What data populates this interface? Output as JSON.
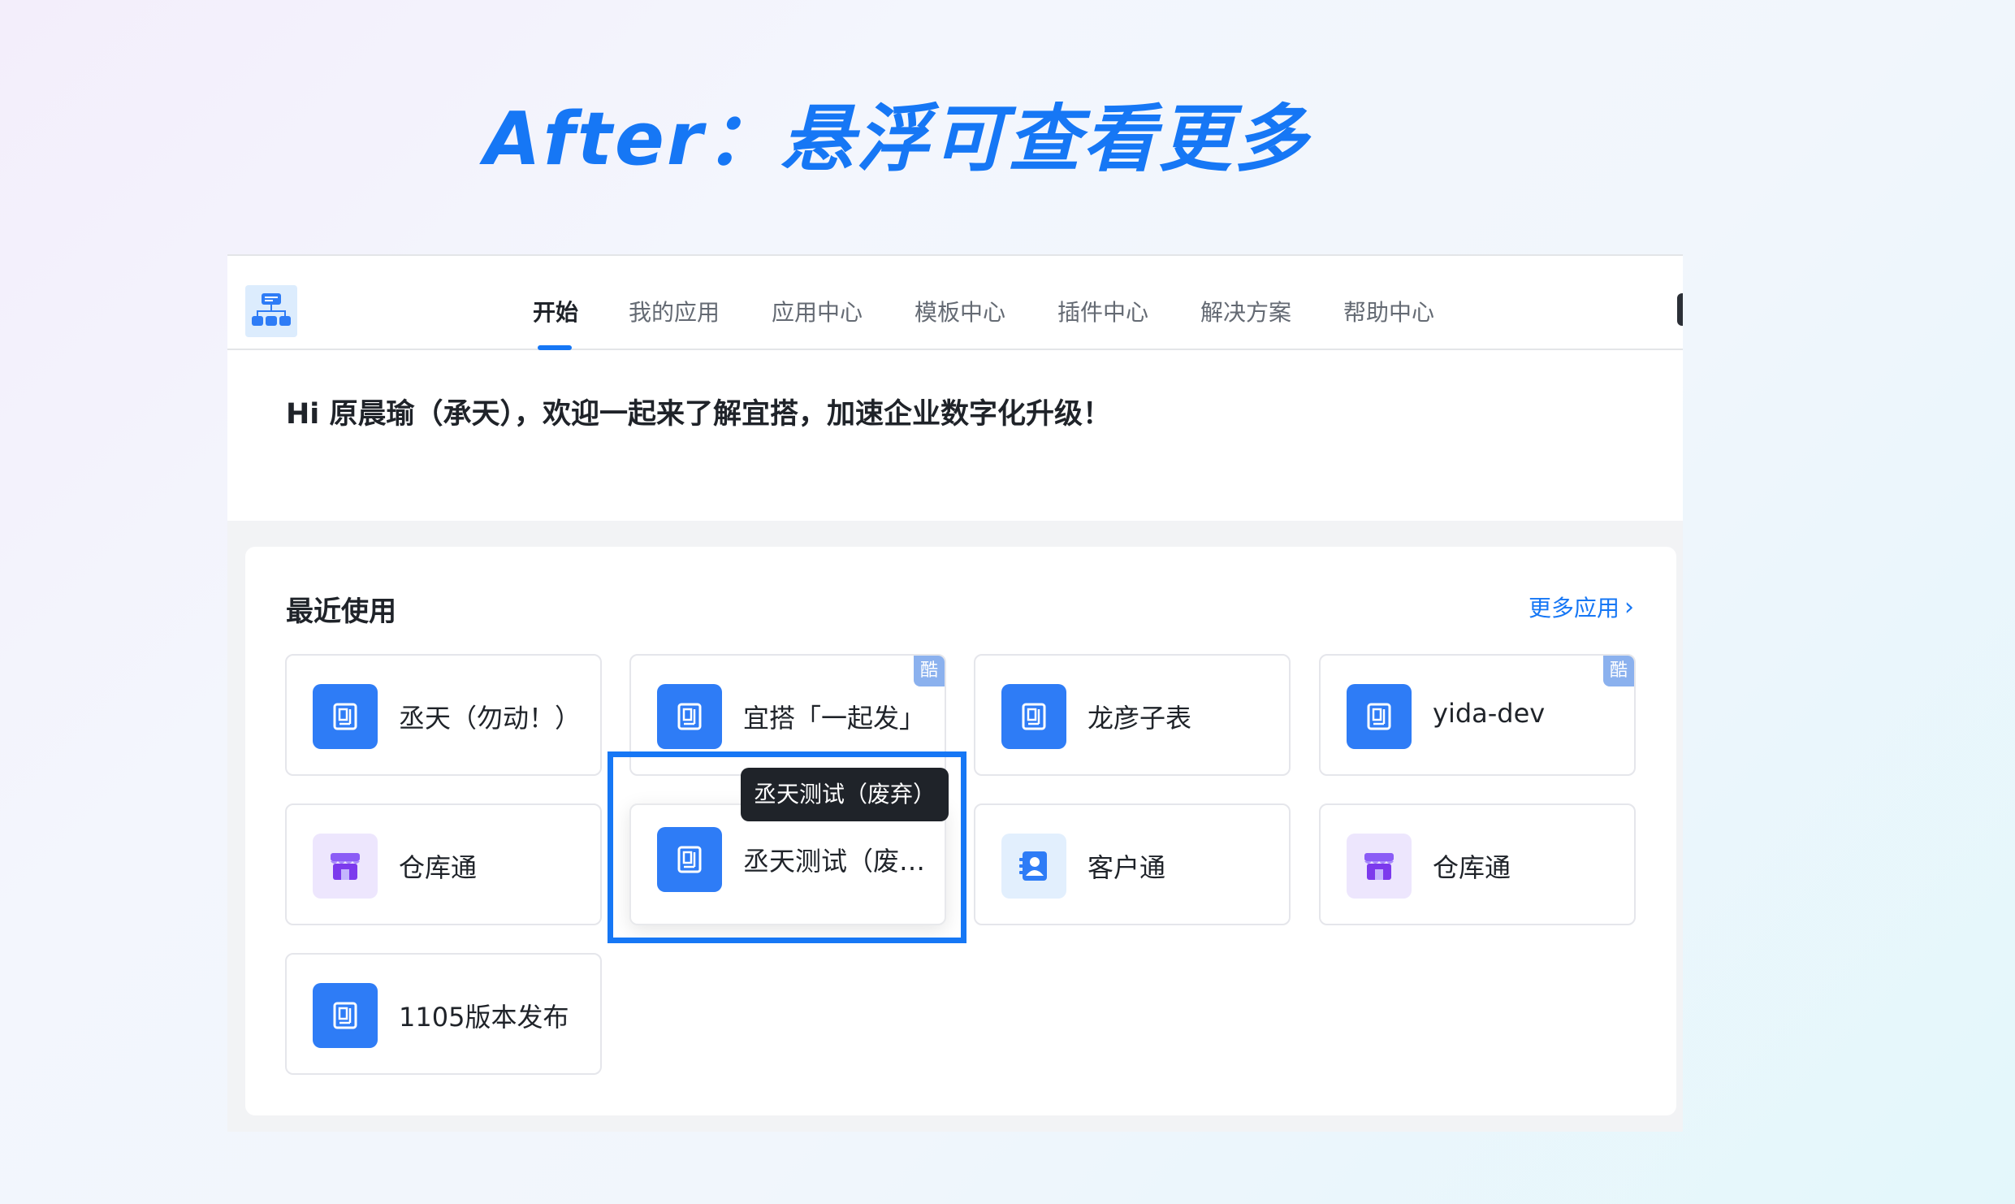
{
  "headline": "After：悬浮可查看更多",
  "nav": {
    "items": [
      {
        "label": "开始",
        "active": true
      },
      {
        "label": "我的应用"
      },
      {
        "label": "应用中心"
      },
      {
        "label": "模板中心"
      },
      {
        "label": "插件中心"
      },
      {
        "label": "解决方案"
      },
      {
        "label": "帮助中心"
      }
    ]
  },
  "greeting": "Hi 原晨瑜（承天），欢迎一起来了解宜搭，加速企业数字化升级！",
  "recent": {
    "title": "最近使用",
    "more_label": "更多应用",
    "cards": [
      {
        "name": "丞天（勿动！）",
        "icon": "document-icon",
        "badge": ""
      },
      {
        "name": "宜搭「一起发」",
        "icon": "document-icon",
        "badge": "酷"
      },
      {
        "name": "龙彦子表",
        "icon": "document-icon",
        "badge": ""
      },
      {
        "name": "yida-dev",
        "icon": "document-icon",
        "badge": "酷"
      },
      {
        "name": "仓库通",
        "icon": "store-icon",
        "badge": ""
      },
      {
        "name": "丞天测试（废…",
        "icon": "document-icon",
        "badge": ""
      },
      {
        "name": "客户通",
        "icon": "contact-icon",
        "badge": ""
      },
      {
        "name": "仓库通",
        "icon": "store-icon",
        "badge": ""
      },
      {
        "name": "1105版本发布",
        "icon": "document-icon",
        "badge": ""
      }
    ]
  },
  "tooltip": "丞天测试（废弃）",
  "colors": {
    "accent": "#1677f5",
    "icon_blue": "#2e7cf6",
    "tooltip_bg": "#1f2329"
  }
}
